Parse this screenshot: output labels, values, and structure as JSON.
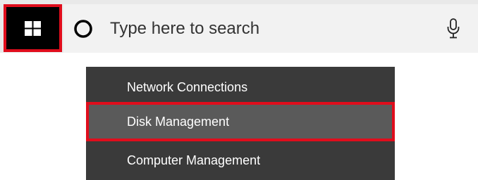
{
  "taskbar": {
    "start_icon": "windows-logo-icon",
    "highlight_color": "#e00d1c",
    "search": {
      "placeholder": "Type here to search",
      "left_icon": "cortana-circle-icon",
      "right_icon": "microphone-icon"
    }
  },
  "context_menu": {
    "items": [
      {
        "label": "Network Connections"
      },
      {
        "label": "Disk Management",
        "highlighted": true
      },
      {
        "label": "Computer Management"
      }
    ]
  }
}
